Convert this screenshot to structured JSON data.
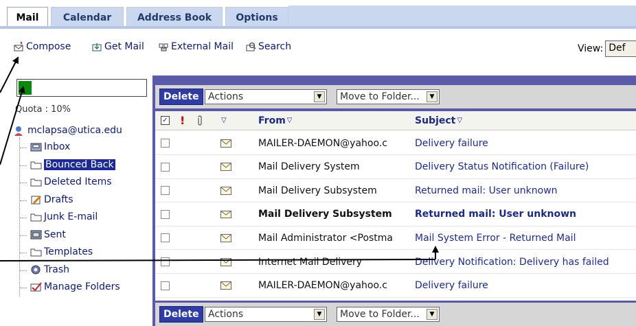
{
  "tabs": [
    {
      "label": "Mail",
      "active": true
    },
    {
      "label": "Calendar",
      "active": false
    },
    {
      "label": "Address Book",
      "active": false
    },
    {
      "label": "Options",
      "active": false
    }
  ],
  "toolbar": {
    "compose": "Compose",
    "get_mail": "Get Mail",
    "external_mail": "External Mail",
    "search": "Search",
    "view_label": "View:",
    "view_value": "Def"
  },
  "quota": {
    "label": "Quota : 10%",
    "fraction": 0.1
  },
  "folders": {
    "account": "mclapsa@utica.edu",
    "items": [
      {
        "label": "Inbox",
        "icon": "inbox-icon",
        "selected": false
      },
      {
        "label": "Bounced Back",
        "icon": "folder-icon",
        "selected": true
      },
      {
        "label": "Deleted Items",
        "icon": "folder-icon",
        "selected": false
      },
      {
        "label": "Drafts",
        "icon": "drafts-icon",
        "selected": false
      },
      {
        "label": "Junk E-mail",
        "icon": "folder-icon",
        "selected": false
      },
      {
        "label": "Sent",
        "icon": "sent-icon",
        "selected": false
      },
      {
        "label": "Templates",
        "icon": "folder-icon",
        "selected": false
      },
      {
        "label": "Trash",
        "icon": "trash-icon",
        "selected": false
      },
      {
        "label": "Manage Folders",
        "icon": "manage-folders-icon",
        "selected": false
      }
    ]
  },
  "actions": {
    "delete": "Delete",
    "actions_select": "Actions",
    "move_select": "Move to Folder..."
  },
  "list": {
    "col_from": "From",
    "col_subject": "Subject",
    "rows": [
      {
        "from": "MAILER-DAEMON@yahoo.c",
        "subject": "Delivery failure",
        "unread": false
      },
      {
        "from": "Mail Delivery System",
        "subject": "Delivery Status Notification (Failure)",
        "unread": false
      },
      {
        "from": "Mail Delivery Subsystem",
        "subject": "Returned mail: User unknown",
        "unread": false
      },
      {
        "from": "Mail Delivery Subsystem",
        "subject": "Returned mail: User unknown",
        "unread": true
      },
      {
        "from": "Mail Administrator <Postma",
        "subject": "Mail System Error - Returned Mail",
        "unread": false
      },
      {
        "from": "Internet Mail Delivery",
        "subject": "Delivery Notification: Delivery has failed",
        "unread": false
      },
      {
        "from": "MAILER-DAEMON@yahoo.c",
        "subject": "Delivery failure",
        "unread": false
      }
    ]
  },
  "colors": {
    "panel": "#5a5aa8",
    "selected_folder": "#1b2a98",
    "quota_fill": "#0a8a0a",
    "link": "#1b2aa0"
  }
}
